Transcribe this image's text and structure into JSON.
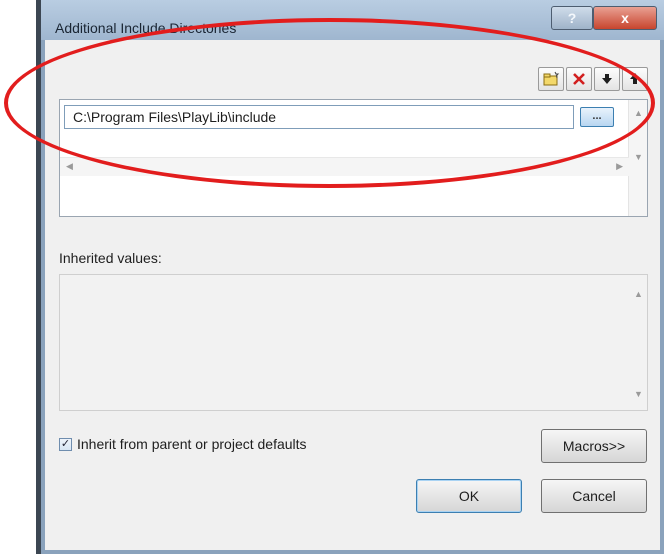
{
  "window": {
    "title": "Additional Include Directories",
    "help_label": "?",
    "close_label": "x"
  },
  "toolbar": {
    "buttons": [
      {
        "icon": "new-folder-icon"
      },
      {
        "icon": "delete-icon"
      },
      {
        "icon": "move-down-icon"
      },
      {
        "icon": "move-up-icon"
      }
    ]
  },
  "directories": {
    "entries": [
      {
        "value": "C:\\Program Files\\PlayLib\\include"
      }
    ],
    "browse_label": "..."
  },
  "inherited": {
    "label": "Inherited values:",
    "values": []
  },
  "options": {
    "inherit_label": "Inherit from parent or project defaults",
    "inherit_checked": true
  },
  "buttons": {
    "macros": "Macros>>",
    "ok": "OK",
    "cancel": "Cancel"
  },
  "colors": {
    "annotation": "#e21d1d",
    "title_bar": "#9fb6cf",
    "close_button": "#c8452e"
  }
}
